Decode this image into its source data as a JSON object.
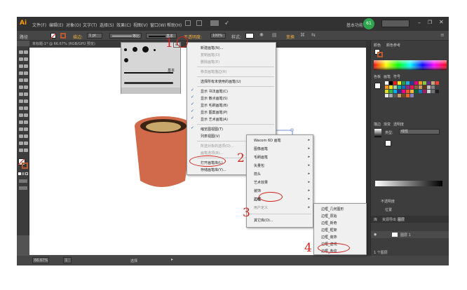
{
  "app": {
    "logo": "Ai",
    "doc_tab": "未标题-1* @ 66.67% (RGB/GPU 预览)"
  },
  "menubar": {
    "items": [
      "文件(F)",
      "编辑(E)",
      "对象(O)",
      "文字(T)",
      "选择(S)",
      "效果(C)",
      "视图(V)",
      "窗口(W)",
      "帮助(H)"
    ],
    "workspace": "基本功能",
    "badge": "61"
  },
  "control": {
    "left_label": "路径",
    "stroke_label": "描边:",
    "stroke_value": "1 pt",
    "profile_label": "等比",
    "brush_label": "基本",
    "opacity_label": "不透明度:",
    "opacity_value": "100%",
    "style_label": "样式:",
    "transform": "变换"
  },
  "brush_panel": {
    "label": "基本"
  },
  "flyout": {
    "items": [
      {
        "label": "新建画笔(N)...",
        "disabled": false,
        "checked": false
      },
      {
        "label": "复制画笔(D)",
        "disabled": true,
        "checked": false
      },
      {
        "label": "删除画笔(E)",
        "disabled": true,
        "checked": false
      },
      {
        "label": "移去画笔描边(R)",
        "disabled": true,
        "checked": false
      },
      {
        "label": "选择所有未使用的画笔(U)",
        "disabled": false,
        "checked": false
      },
      {
        "label": "显示 书法画笔(C)",
        "disabled": false,
        "checked": true
      },
      {
        "label": "显示 散点画笔(S)",
        "disabled": false,
        "checked": true
      },
      {
        "label": "显示 毛刷画笔(B)",
        "disabled": false,
        "checked": true
      },
      {
        "label": "显示 图案画笔(P)",
        "disabled": false,
        "checked": true
      },
      {
        "label": "显示 艺术画笔(A)",
        "disabled": false,
        "checked": true
      },
      {
        "label": "缩览图视图(T)",
        "disabled": false,
        "checked": true
      },
      {
        "label": "列表视图(V)",
        "disabled": false,
        "checked": false
      },
      {
        "label": "所选对象的选项(O)...",
        "disabled": true,
        "checked": false
      },
      {
        "label": "画笔选项(B)...",
        "disabled": true,
        "checked": false
      },
      {
        "label": "打开画笔库(L)",
        "disabled": false,
        "checked": false,
        "submenu": true
      },
      {
        "label": "存储画笔库(Y)...",
        "disabled": false,
        "checked": false
      }
    ]
  },
  "submenu_libraries": {
    "items": [
      {
        "label": "Wacom 6D 画笔",
        "submenu": true
      },
      {
        "label": "图像画笔",
        "submenu": true
      },
      {
        "label": "毛刷画笔",
        "submenu": true
      },
      {
        "label": "矢量包",
        "submenu": true
      },
      {
        "label": "箭头",
        "submenu": true
      },
      {
        "label": "艺术效果",
        "submenu": true
      },
      {
        "label": "装饰",
        "submenu": true
      },
      {
        "label": "边框",
        "submenu": true
      },
      {
        "label": "用户定义",
        "submenu": true
      },
      {
        "label": "其它库(O)...",
        "submenu": false
      }
    ]
  },
  "submenu_borders": {
    "items": [
      "边框_几何图形",
      "边框_原始",
      "边框_新奇",
      "边框_框架",
      "边框_装饰",
      "边框_虚线",
      "边框_条纹"
    ]
  },
  "annotations": {
    "n1": "1",
    "n2": "2",
    "n3": "3",
    "n4": "4"
  },
  "right_panel": {
    "tabs_top": [
      "颜色",
      "颜色参考"
    ],
    "tabs_swatch": [
      "色板",
      "画笔",
      "符号"
    ],
    "tabs_stroke": [
      "描边",
      "渐变",
      "透明度"
    ],
    "gradient": {
      "type_label": "类型:",
      "type_value": "线性"
    },
    "opacity_label": "不透明度",
    "position_label": "位置",
    "tabs_layers": [
      "库",
      "资源导出",
      "图层"
    ],
    "layer_name": "图层 1",
    "layer_count": "1 个图层"
  },
  "status": {
    "zoom": "66.67%",
    "page": "1",
    "tool": "选择"
  },
  "colors": {
    "accent": "#d2231c",
    "cup": "#d06a4a",
    "cup_rim": "#3b2313",
    "cup_inner": "#c8a86a"
  }
}
